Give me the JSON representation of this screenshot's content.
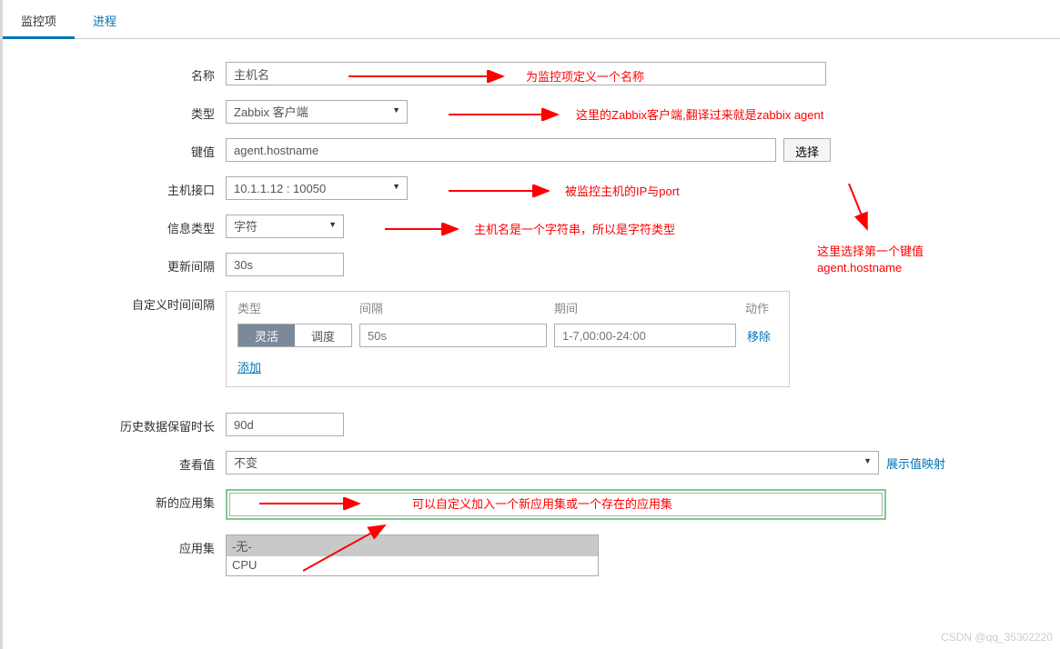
{
  "tabs": {
    "monitor": "监控项",
    "process": "进程"
  },
  "labels": {
    "name": "名称",
    "type": "类型",
    "key": "键值",
    "host": "主机接口",
    "info": "信息类型",
    "update": "更新间隔",
    "custom": "自定义时间间隔",
    "history": "历史数据保留时长",
    "view": "查看值",
    "newapp": "新的应用集",
    "app": "应用集"
  },
  "values": {
    "name": "主机名",
    "type": "Zabbix 客户端",
    "key": "agent.hostname",
    "host": "10.1.1.12 : 10050",
    "info": "字符",
    "update": "30s",
    "history": "90d",
    "view": "不变",
    "newapp": ""
  },
  "buttons": {
    "select": "选择"
  },
  "custom": {
    "headers": {
      "type": "类型",
      "interval": "间隔",
      "period": "期间",
      "action": "动作"
    },
    "toggle": {
      "flex": "灵活",
      "sched": "调度"
    },
    "interval_ph": "50s",
    "period_ph": "1-7,00:00-24:00",
    "remove": "移除",
    "add": "添加"
  },
  "viewlink": "展示值映射",
  "applist": {
    "none": "-无-",
    "cpu": "CPU"
  },
  "annotations": {
    "a1": "为监控项定义一个名称",
    "a2": "这里的Zabbix客户端,翻译过来就是zabbix agent",
    "a3": "被监控主机的IP与port",
    "a4": "主机名是一个字符串，所以是字符类型",
    "a5": "这里选择第一个键值agent.hostname",
    "a6": "可以自定义加入一个新应用集或一个存在的应用集"
  },
  "watermark": "CSDN @qq_35302220"
}
